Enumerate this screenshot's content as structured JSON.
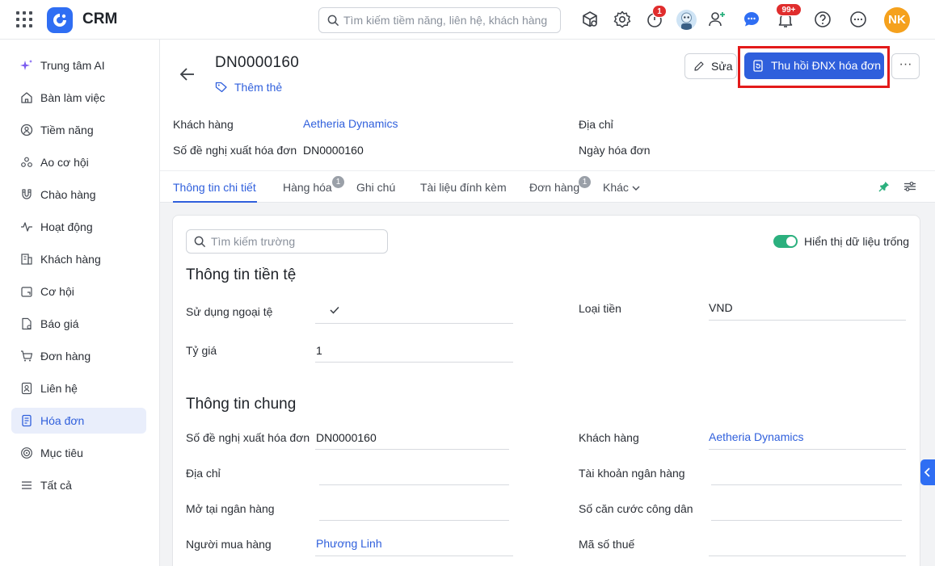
{
  "app": {
    "title": "CRM"
  },
  "search": {
    "placeholder": "Tìm kiếm tiềm năng, liên hệ, khách hàng"
  },
  "top_icons": [
    "cube-search-icon",
    "gear-icon",
    "timer-icon",
    "robot-avatar-icon",
    "add-user-icon",
    "chat-icon",
    "bell-icon",
    "help-icon",
    "more-circle-icon"
  ],
  "notifications": {
    "timer_badge": "1",
    "bell_badge": "99+"
  },
  "user": {
    "initials": "NK",
    "color": "#f5a11d"
  },
  "sidebar": {
    "items": [
      {
        "label": "Trung tâm AI",
        "icon": "sparkle-icon"
      },
      {
        "label": "Bàn làm việc",
        "icon": "home-icon"
      },
      {
        "label": "Tiềm năng",
        "icon": "target-user-icon"
      },
      {
        "label": "Ao cơ hội",
        "icon": "group-icon"
      },
      {
        "label": "Chào hàng",
        "icon": "magnet-icon"
      },
      {
        "label": "Hoạt động",
        "icon": "activity-icon"
      },
      {
        "label": "Khách hàng",
        "icon": "building-icon"
      },
      {
        "label": "Cơ hội",
        "icon": "opportunity-icon"
      },
      {
        "label": "Báo giá",
        "icon": "quote-icon"
      },
      {
        "label": "Đơn hàng",
        "icon": "cart-icon"
      },
      {
        "label": "Liên hệ",
        "icon": "contact-icon"
      },
      {
        "label": "Hóa đơn",
        "icon": "invoice-icon",
        "active": true
      },
      {
        "label": "Mục tiêu",
        "icon": "goal-icon"
      },
      {
        "label": "Tất cả",
        "icon": "menu-icon"
      }
    ]
  },
  "header": {
    "doc_id": "DN0000160",
    "add_tag": "Thêm thẻ",
    "edit_label": "Sửa",
    "primary_action": "Thu hồi ĐNX hóa đơn",
    "more_label": "···"
  },
  "summary": {
    "customer_label": "Khách hàng",
    "customer_value": "Aetheria Dynamics",
    "request_no_label": "Số đề nghị xuất hóa đơn",
    "request_no_value": "DN0000160",
    "address_label": "Địa chỉ",
    "invoice_date_label": "Ngày hóa đơn"
  },
  "tabs": [
    {
      "label": "Thông tin chi tiết",
      "active": true
    },
    {
      "label": "Hàng hóa",
      "badge": "1"
    },
    {
      "label": "Ghi chú"
    },
    {
      "label": "Tài liệu đính kèm"
    },
    {
      "label": "Đơn hàng",
      "badge": "1"
    },
    {
      "label": "Khác"
    }
  ],
  "detail": {
    "field_search_placeholder": "Tìm kiếm trường",
    "show_empty_label": "Hiển thị dữ liệu trống",
    "show_empty_on": true,
    "currency_section": {
      "title": "Thông tin tiền tệ",
      "foreign_currency_label": "Sử dụng ngoại tệ",
      "foreign_currency_checked": true,
      "currency_type_label": "Loại tiền",
      "currency_type_value": "VND",
      "rate_label": "Tỷ giá",
      "rate_value": "1"
    },
    "general_section": {
      "title": "Thông tin chung",
      "request_no_label": "Số đề nghị xuất hóa đơn",
      "request_no_value": "DN0000160",
      "customer_label": "Khách hàng",
      "customer_value": "Aetheria Dynamics",
      "address_label": "Địa chỉ",
      "bank_account_label": "Tài khoản ngân hàng",
      "bank_open_label": "Mở tại ngân hàng",
      "citizen_id_label": "Số căn cước công dân",
      "buyer_label": "Người mua hàng",
      "buyer_value": "Phương Linh",
      "tax_code_label": "Mã số thuế"
    }
  },
  "colors": {
    "accent": "#2f5fdc",
    "brand": "#2f6ef3",
    "highlight": "#e31a1a",
    "toggle": "#2bb07e"
  }
}
